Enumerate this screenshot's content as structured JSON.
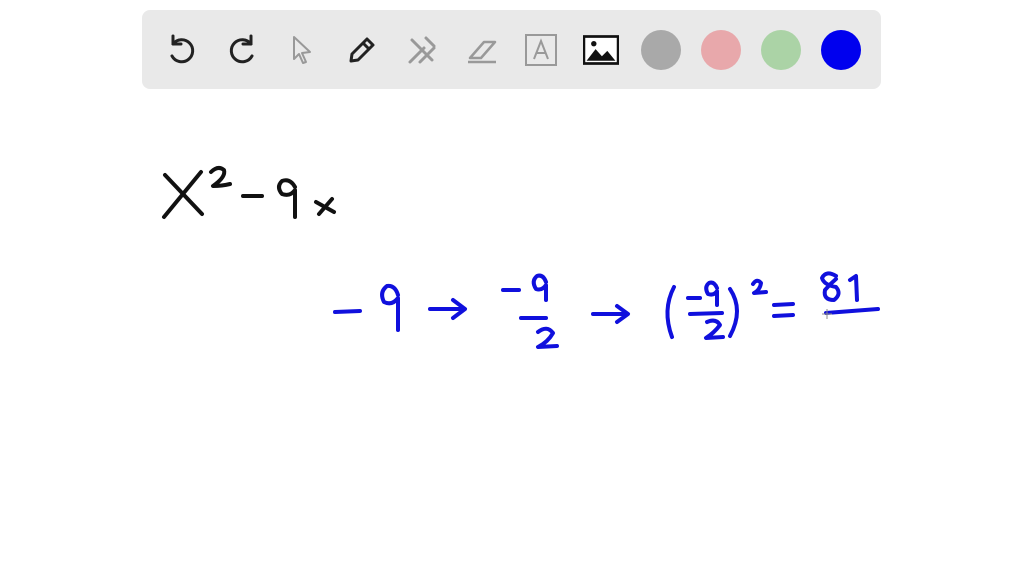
{
  "toolbar": {
    "tools": [
      {
        "name": "undo",
        "icon": "undo-icon"
      },
      {
        "name": "redo",
        "icon": "redo-icon"
      },
      {
        "name": "select",
        "icon": "cursor-icon"
      },
      {
        "name": "pen",
        "icon": "pencil-icon"
      },
      {
        "name": "tools",
        "icon": "tools-icon"
      },
      {
        "name": "eraser",
        "icon": "eraser-icon"
      },
      {
        "name": "text",
        "icon": "text-box-icon",
        "glyph": "A"
      },
      {
        "name": "image",
        "icon": "image-icon"
      }
    ],
    "colors": [
      "#a9a9a9",
      "#e8a8ab",
      "#abd3a6",
      "#0000ee"
    ],
    "active_color": "#0000ee"
  },
  "canvas": {
    "ink_black": "#111111",
    "ink_blue": "#1010dd"
  }
}
